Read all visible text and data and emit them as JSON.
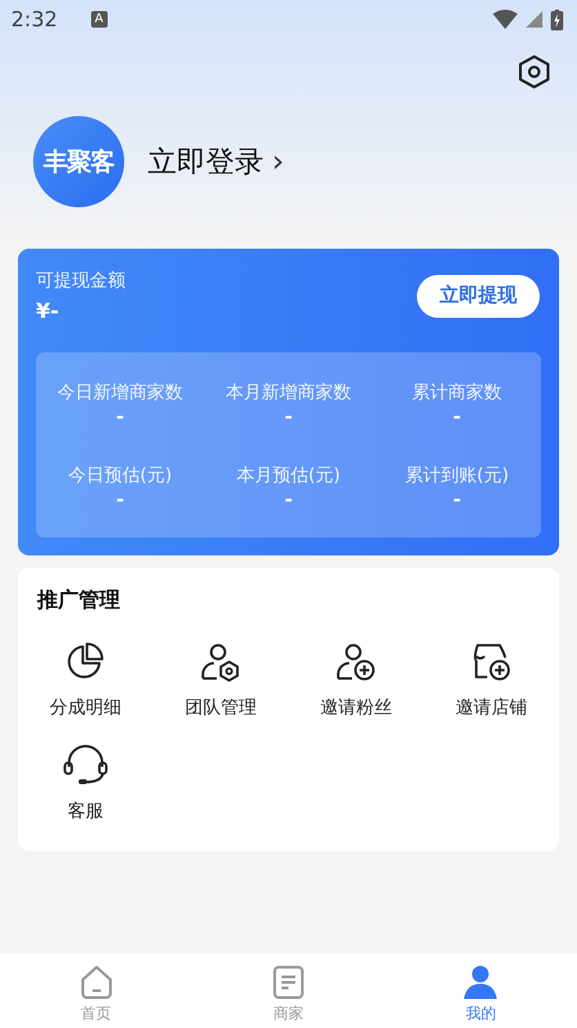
{
  "status_bar": {
    "time": "2:32",
    "notice": "A"
  },
  "profile": {
    "logo": "丰聚客",
    "login": "立即登录",
    "chevron": "›"
  },
  "wallet": {
    "label": "可提现金额",
    "amount": "¥-",
    "button": "立即提现",
    "stats": [
      {
        "label": "今日新增商家数",
        "value": "-"
      },
      {
        "label": "本月新增商家数",
        "value": "-"
      },
      {
        "label": "累计商家数",
        "value": "-"
      },
      {
        "label": "今日预估(元)",
        "value": "-"
      },
      {
        "label": "本月预估(元)",
        "value": "-"
      },
      {
        "label": "累计到账(元)",
        "value": "-"
      }
    ]
  },
  "promotion": {
    "title": "推广管理",
    "items": [
      {
        "kind": "pie",
        "label": "分成明细"
      },
      {
        "kind": "team",
        "label": "团队管理"
      },
      {
        "kind": "invite-user",
        "label": "邀请粉丝"
      },
      {
        "kind": "invite-shop",
        "label": "邀请店铺"
      },
      {
        "kind": "headset",
        "label": "客服"
      }
    ]
  },
  "tabs": [
    {
      "kind": "home",
      "label": "首页",
      "selected": false
    },
    {
      "kind": "doc",
      "label": "商家",
      "selected": false
    },
    {
      "kind": "user",
      "label": "我的",
      "selected": true
    }
  ]
}
